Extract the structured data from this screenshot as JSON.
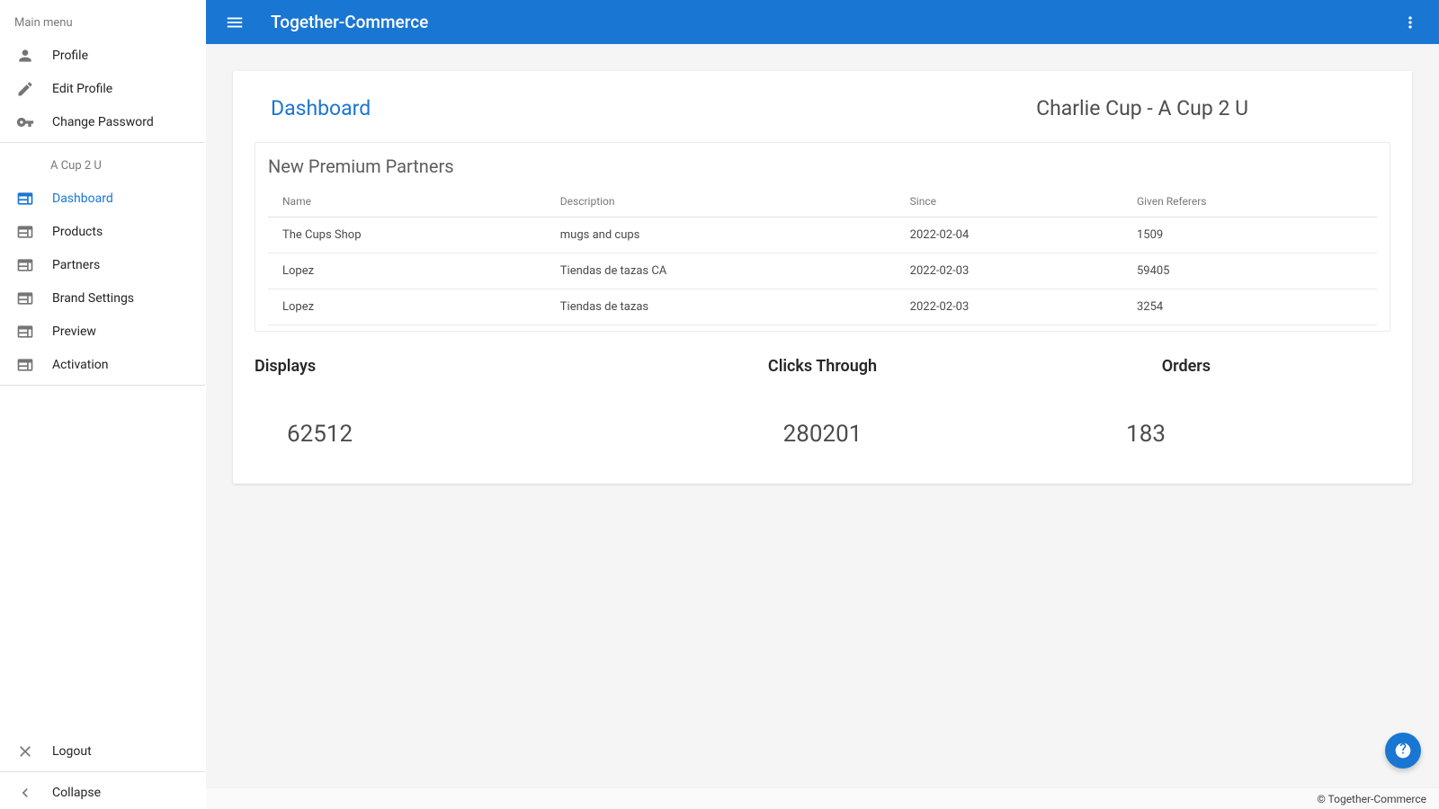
{
  "topbar": {
    "title": "Together-Commerce"
  },
  "sidebar": {
    "main_menu_header": "Main menu",
    "items_top": [
      {
        "label": "Profile"
      },
      {
        "label": "Edit Profile"
      },
      {
        "label": "Change Password"
      }
    ],
    "brand_header": "A Cup 2 U",
    "items_brand": [
      {
        "label": "Dashboard",
        "active": true
      },
      {
        "label": "Products"
      },
      {
        "label": "Partners"
      },
      {
        "label": "Brand Settings"
      },
      {
        "label": "Preview"
      },
      {
        "label": "Activation"
      }
    ],
    "logout_label": "Logout",
    "collapse_label": "Collapse"
  },
  "dashboard": {
    "page_title": "Dashboard",
    "user_brand": "Charlie Cup - A Cup 2 U",
    "partners_panel_title": "New Premium Partners",
    "partners_columns": {
      "name": "Name",
      "description": "Description",
      "since": "Since",
      "referers": "Given Referers"
    },
    "partners": [
      {
        "name": "The Cups Shop",
        "description": "mugs and cups",
        "since": "2022-02-04",
        "referers": "1509"
      },
      {
        "name": "Lopez",
        "description": "Tiendas de tazas CA",
        "since": "2022-02-03",
        "referers": "59405"
      },
      {
        "name": "Lopez",
        "description": "Tiendas de tazas",
        "since": "2022-02-03",
        "referers": "3254"
      }
    ],
    "stats": {
      "displays_label": "Displays",
      "displays_value": "62512",
      "clicks_label": "Clicks Through",
      "clicks_value": "280201",
      "orders_label": "Orders",
      "orders_value": "183"
    }
  },
  "footer": {
    "copyright": "© Together-Commerce"
  }
}
